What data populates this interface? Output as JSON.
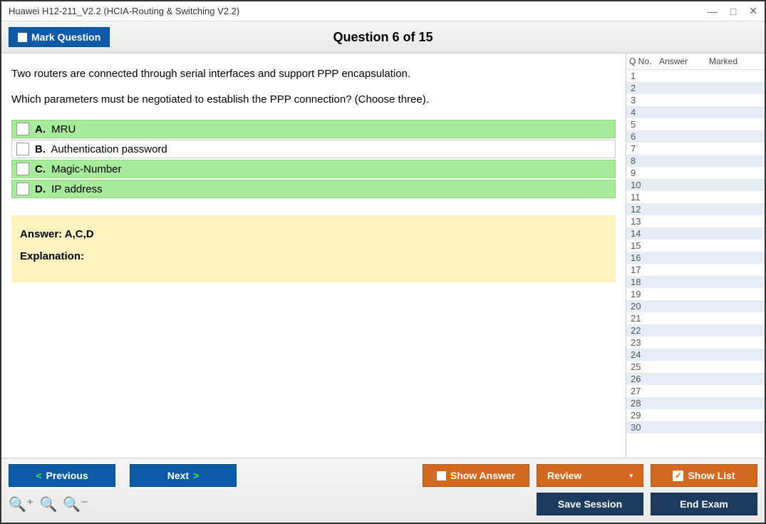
{
  "window": {
    "title": "Huawei H12-211_V2.2 (HCIA-Routing & Switching V2.2)"
  },
  "header": {
    "mark": "Mark Question",
    "qnum": "Question 6 of 15"
  },
  "question": {
    "line1": "Two routers are connected through serial interfaces and support PPP encapsulation.",
    "line2": "Which parameters must be negotiated to establish the PPP connection? (Choose three)."
  },
  "options": [
    {
      "letter": "A.",
      "text": "MRU",
      "correct": true
    },
    {
      "letter": "B.",
      "text": "Authentication password",
      "correct": false
    },
    {
      "letter": "C.",
      "text": "Magic-Number",
      "correct": true
    },
    {
      "letter": "D.",
      "text": "IP address",
      "correct": true
    }
  ],
  "answer": {
    "label": "Answer: A,C,D",
    "explanation_label": "Explanation:"
  },
  "sidebar": {
    "h1": "Q No.",
    "h2": "Answer",
    "h3": "Marked",
    "rows": 30
  },
  "footer": {
    "prev": "Previous",
    "next": "Next",
    "show_answer": "Show Answer",
    "review": "Review",
    "show_list": "Show List",
    "save": "Save Session",
    "end": "End Exam"
  }
}
